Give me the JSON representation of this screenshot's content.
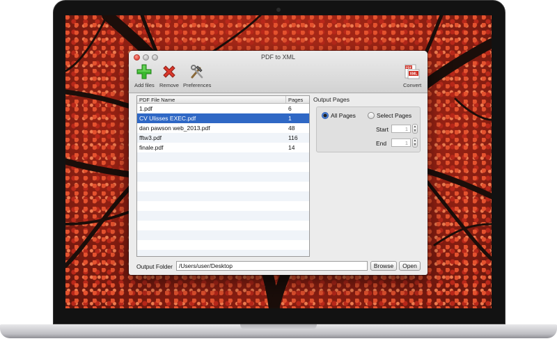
{
  "window": {
    "title": "PDF to XML"
  },
  "toolbar": {
    "add_label": "Add files",
    "remove_label": "Remove",
    "preferences_label": "Preferences",
    "convert_label": "Convert",
    "convert_icon_top": "PDF",
    "convert_icon_bottom": "XML"
  },
  "table": {
    "headers": {
      "name": "PDF File Name",
      "pages": "Pages"
    },
    "rows": [
      {
        "name": "1.pdf",
        "pages": "6",
        "selected": false
      },
      {
        "name": "CV Ulisses EXEC.pdf",
        "pages": "1",
        "selected": true
      },
      {
        "name": "dan pawson web_2013.pdf",
        "pages": "48",
        "selected": false
      },
      {
        "name": "fftw3.pdf",
        "pages": "116",
        "selected": false
      },
      {
        "name": "finale.pdf",
        "pages": "14",
        "selected": false
      }
    ]
  },
  "output_pages": {
    "title": "Output Pages",
    "all_pages_label": "All Pages",
    "select_pages_label": "Select Pages",
    "selected_option": "all",
    "start_label": "Start",
    "start_value": "1",
    "end_label": "End",
    "end_value": "1"
  },
  "output_folder": {
    "label": "Output Folder",
    "path": "/Users/user/Desktop",
    "browse_label": "Browse",
    "open_label": "Open"
  },
  "colors": {
    "selection": "#2f68c5",
    "add_icon": "#3bb92f",
    "remove_icon": "#d9372b",
    "close_button": "#e0443a"
  }
}
